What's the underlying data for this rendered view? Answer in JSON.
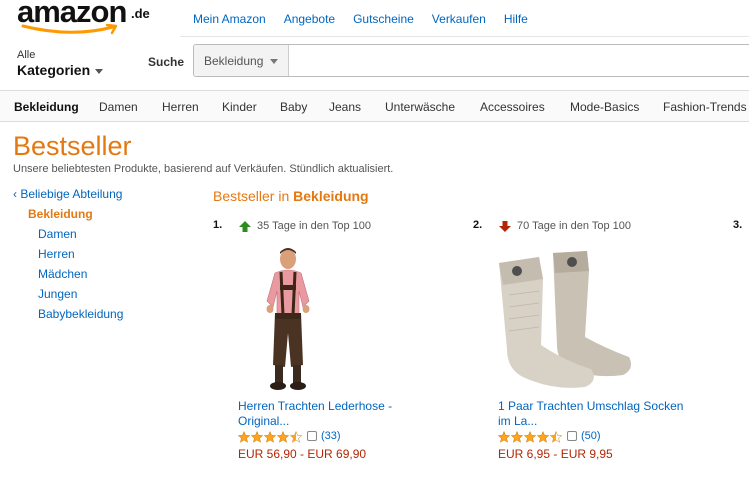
{
  "header": {
    "logo_text": "amazon",
    "logo_tld": ".de",
    "top_links": [
      "Mein Amazon",
      "Angebote",
      "Gutscheine",
      "Verkaufen",
      "Hilfe"
    ],
    "dept_line1": "Alle",
    "dept_line2": "Kategorien",
    "search_label": "Suche",
    "search_scope": "Bekleidung",
    "search_value": ""
  },
  "subnav": [
    "Bekleidung",
    "Damen",
    "Herren",
    "Kinder",
    "Baby",
    "Jeans",
    "Unterwäsche",
    "Accessoires",
    "Mode-Basics",
    "Fashion-Trends"
  ],
  "page": {
    "title": "Bestseller",
    "subtitle": "Unsere beliebtesten Produkte, basierend auf Verkäufen. Stündlich aktualisiert."
  },
  "leftnav": {
    "any": "‹ Beliebige Abteilung",
    "current": "Bekleidung",
    "items": [
      "Damen",
      "Herren",
      "Mädchen",
      "Jungen",
      "Babybekleidung"
    ]
  },
  "main": {
    "heading_prefix": "Bestseller in",
    "heading_category": "Bekleidung"
  },
  "products": [
    {
      "rank": "1.",
      "trend": "up",
      "days": "35 Tage in den Top 100",
      "title": "Herren Trachten Lederhose - Original...",
      "rating": 4.5,
      "reviews": "(33)",
      "price": "EUR 56,90 - EUR 69,90"
    },
    {
      "rank": "2.",
      "trend": "down",
      "days": "70 Tage in den Top 100",
      "title": "1 Paar Trachten Umschlag Socken im La...",
      "rating": 4.5,
      "reviews": "(50)",
      "price": "EUR 6,95 - EUR 9,95"
    }
  ],
  "rank3": "3.",
  "colors": {
    "accent": "#e47911",
    "link": "#0066c0",
    "price": "#b12704",
    "star": "#ffa41c",
    "trend_up": "#2e8b1e",
    "trend_down": "#b12704"
  }
}
